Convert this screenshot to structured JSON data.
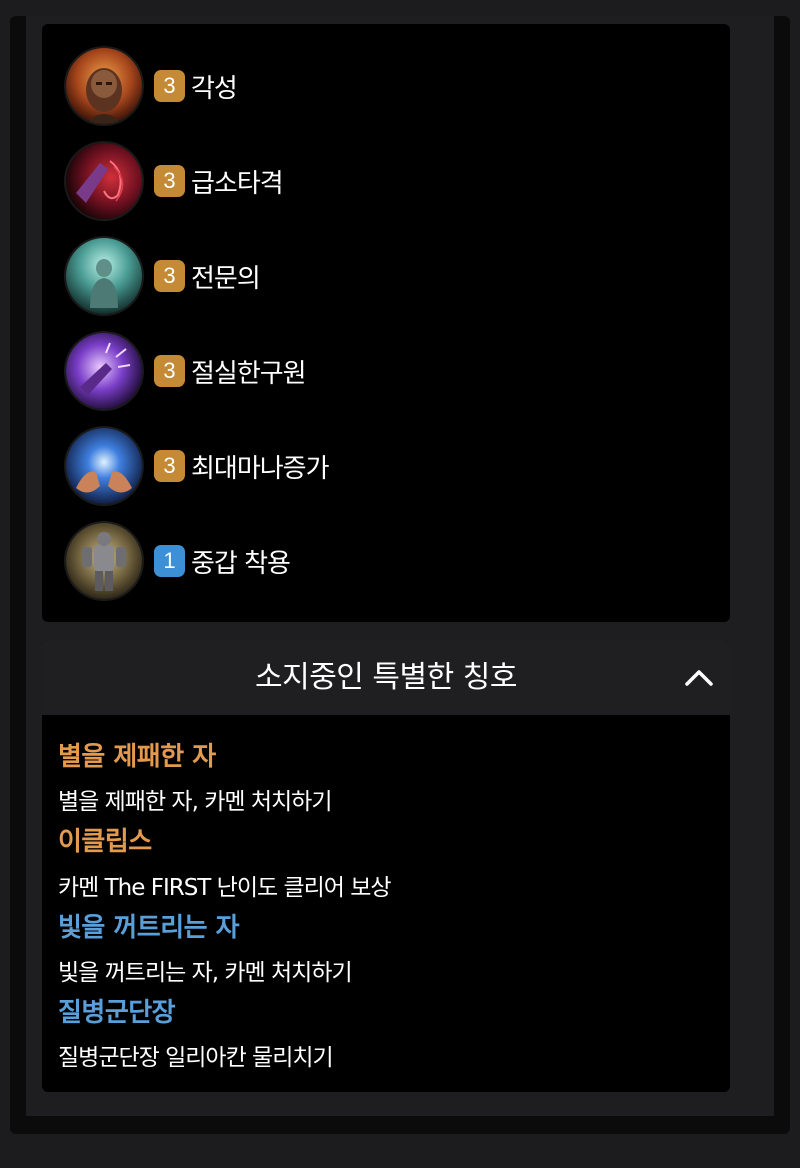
{
  "colors": {
    "background": "#1c1c1e",
    "panel": "#000000",
    "header": "#1f1f22",
    "badge_orange": "#c48a36",
    "badge_blue": "#3d8fd6",
    "title_orange": "#e39a4e",
    "title_blue": "#5b9fd9"
  },
  "engravings": [
    {
      "level": "3",
      "name": "각성",
      "icon": "awakening-icon",
      "badge_color": "#c48a36"
    },
    {
      "level": "3",
      "name": "급소타격",
      "icon": "vital-strike-icon",
      "badge_color": "#c48a36"
    },
    {
      "level": "3",
      "name": "전문의",
      "icon": "specialist-icon",
      "badge_color": "#c48a36"
    },
    {
      "level": "3",
      "name": "절실한구원",
      "icon": "desperate-salvation-icon",
      "badge_color": "#c48a36"
    },
    {
      "level": "3",
      "name": "최대마나증가",
      "icon": "max-mana-icon",
      "badge_color": "#c48a36"
    },
    {
      "level": "1",
      "name": "중갑 착용",
      "icon": "heavy-armor-icon",
      "badge_color": "#3d8fd6"
    }
  ],
  "titles_section": {
    "header": "소지중인 특별한 칭호",
    "toggle_icon": "chevron-up-icon",
    "items": [
      {
        "name": "별을 제패한 자",
        "desc": "별을 제패한 자, 카멘 처치하기",
        "color": "#e39a4e"
      },
      {
        "name": "이클립스",
        "desc": "카멘 The FIRST 난이도 클리어 보상",
        "color": "#e39a4e"
      },
      {
        "name": "빛을 꺼트리는 자",
        "desc": "빛을 꺼트리는 자, 카멘 처치하기",
        "color": "#5b9fd9"
      },
      {
        "name": "질병군단장",
        "desc": "질병군단장 일리아칸 물리치기",
        "color": "#5b9fd9"
      }
    ]
  }
}
